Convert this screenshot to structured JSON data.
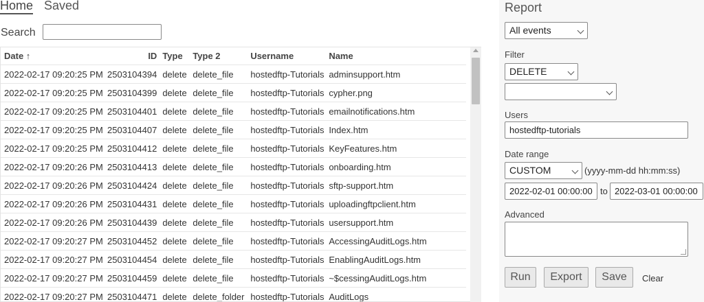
{
  "tabs": {
    "home": "Home",
    "saved": "Saved"
  },
  "search": {
    "label": "Search",
    "value": ""
  },
  "table": {
    "headers": {
      "date": "Date ↑",
      "id": "ID",
      "type": "Type",
      "type2": "Type 2",
      "username": "Username",
      "name": "Name"
    },
    "rows": [
      {
        "date": "2022-02-17 09:20:25 PM",
        "id": "2503104394",
        "type": "delete",
        "type2": "delete_file",
        "username": "hostedftp-Tutorials",
        "name": "adminsupport.htm"
      },
      {
        "date": "2022-02-17 09:20:25 PM",
        "id": "2503104399",
        "type": "delete",
        "type2": "delete_file",
        "username": "hostedftp-Tutorials",
        "name": "cypher.png"
      },
      {
        "date": "2022-02-17 09:20:25 PM",
        "id": "2503104401",
        "type": "delete",
        "type2": "delete_file",
        "username": "hostedftp-Tutorials",
        "name": "emailnotifications.htm"
      },
      {
        "date": "2022-02-17 09:20:25 PM",
        "id": "2503104407",
        "type": "delete",
        "type2": "delete_file",
        "username": "hostedftp-Tutorials",
        "name": "Index.htm"
      },
      {
        "date": "2022-02-17 09:20:25 PM",
        "id": "2503104412",
        "type": "delete",
        "type2": "delete_file",
        "username": "hostedftp-Tutorials",
        "name": "KeyFeatures.htm"
      },
      {
        "date": "2022-02-17 09:20:26 PM",
        "id": "2503104413",
        "type": "delete",
        "type2": "delete_file",
        "username": "hostedftp-Tutorials",
        "name": "onboarding.htm"
      },
      {
        "date": "2022-02-17 09:20:26 PM",
        "id": "2503104424",
        "type": "delete",
        "type2": "delete_file",
        "username": "hostedftp-Tutorials",
        "name": "sftp-support.htm"
      },
      {
        "date": "2022-02-17 09:20:26 PM",
        "id": "2503104431",
        "type": "delete",
        "type2": "delete_file",
        "username": "hostedftp-Tutorials",
        "name": "uploadingftpclient.htm"
      },
      {
        "date": "2022-02-17 09:20:26 PM",
        "id": "2503104439",
        "type": "delete",
        "type2": "delete_file",
        "username": "hostedftp-Tutorials",
        "name": "usersupport.htm"
      },
      {
        "date": "2022-02-17 09:20:27 PM",
        "id": "2503104452",
        "type": "delete",
        "type2": "delete_file",
        "username": "hostedftp-Tutorials",
        "name": "AccessingAuditLogs.htm"
      },
      {
        "date": "2022-02-17 09:20:27 PM",
        "id": "2503104454",
        "type": "delete",
        "type2": "delete_file",
        "username": "hostedftp-Tutorials",
        "name": "EnablingAuditLogs.htm"
      },
      {
        "date": "2022-02-17 09:20:27 PM",
        "id": "2503104459",
        "type": "delete",
        "type2": "delete_file",
        "username": "hostedftp-Tutorials",
        "name": "~$cessingAuditLogs.htm"
      },
      {
        "date": "2022-02-17 09:20:27 PM",
        "id": "2503104471",
        "type": "delete",
        "type2": "delete_folder",
        "username": "hostedftp-Tutorials",
        "name": "AuditLogs"
      }
    ]
  },
  "report": {
    "title": "Report",
    "event_select": "All events",
    "filter_label": "Filter",
    "filter_select": "DELETE",
    "filter_value_select": "",
    "users_label": "Users",
    "users_value": "hostedftp-tutorials",
    "date_range_label": "Date range",
    "date_range_select": "CUSTOM",
    "date_format_hint": "(yyyy-mm-dd hh:mm:ss)",
    "date_from": "2022-02-01 00:00:00",
    "date_to_sep": "to",
    "date_to": "2022-03-01 00:00:00",
    "advanced_label": "Advanced",
    "advanced_value": "",
    "run": "Run",
    "export": "Export",
    "save": "Save",
    "clear": "Clear"
  }
}
